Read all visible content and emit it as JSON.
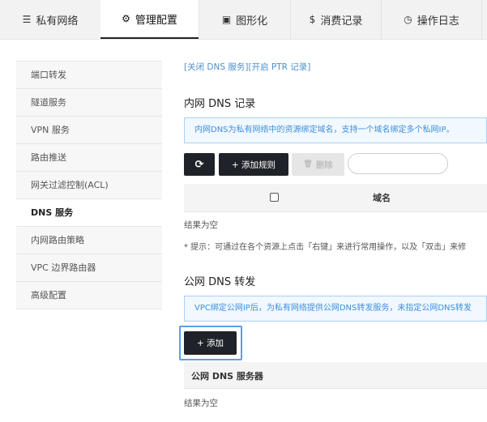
{
  "tabs": [
    {
      "icon": "list-icon",
      "glyph": "☰",
      "label": "私有网络"
    },
    {
      "icon": "gears-icon",
      "glyph": "⚙",
      "label": "管理配置"
    },
    {
      "icon": "image-icon",
      "glyph": "▣",
      "label": "图形化"
    },
    {
      "icon": "dollar-icon",
      "glyph": "$",
      "label": "消费记录"
    },
    {
      "icon": "clock-icon",
      "glyph": "◷",
      "label": "操作日志"
    }
  ],
  "sidebar": {
    "items": [
      {
        "label": "端口转发"
      },
      {
        "label": "隧道服务"
      },
      {
        "label": "VPN 服务"
      },
      {
        "label": "路由推送"
      },
      {
        "label": "网关过滤控制(ACL)"
      },
      {
        "label": "DNS 服务"
      },
      {
        "label": "内网路由策略"
      },
      {
        "label": "VPC 边界路由器"
      },
      {
        "label": "高级配置"
      }
    ]
  },
  "top_links": {
    "close_dns": "[关闭 DNS 服务]",
    "open_ptr": "[开启 PTR 记录]"
  },
  "internal_dns": {
    "title": "内网 DNS 记录",
    "info": "内网DNS为私有网络中的资源绑定域名，支持一个域名绑定多个私网IP。",
    "refresh_glyph": "⟳",
    "add_rule_label": "+ 添加规则",
    "delete_label": "删除",
    "delete_glyph": "🗑",
    "search_placeholder": "",
    "col_domain": "域名",
    "empty_text": "结果为空",
    "hint": "* 提示：可通过在各个资源上点击「右键」来进行常用操作，以及「双击」来修"
  },
  "public_dns": {
    "title": "公网 DNS 转发",
    "info": "VPC绑定公网IP后，为私有网络提供公网DNS转发服务，未指定公网DNS转发",
    "add_label": "+ 添加",
    "col_server": "公网 DNS 服务器",
    "empty_text": "结果为空"
  },
  "colors": {
    "accent_blue": "#4a8fd0",
    "dark_button": "#1f2329",
    "focus_ring": "#5aa0e6"
  }
}
